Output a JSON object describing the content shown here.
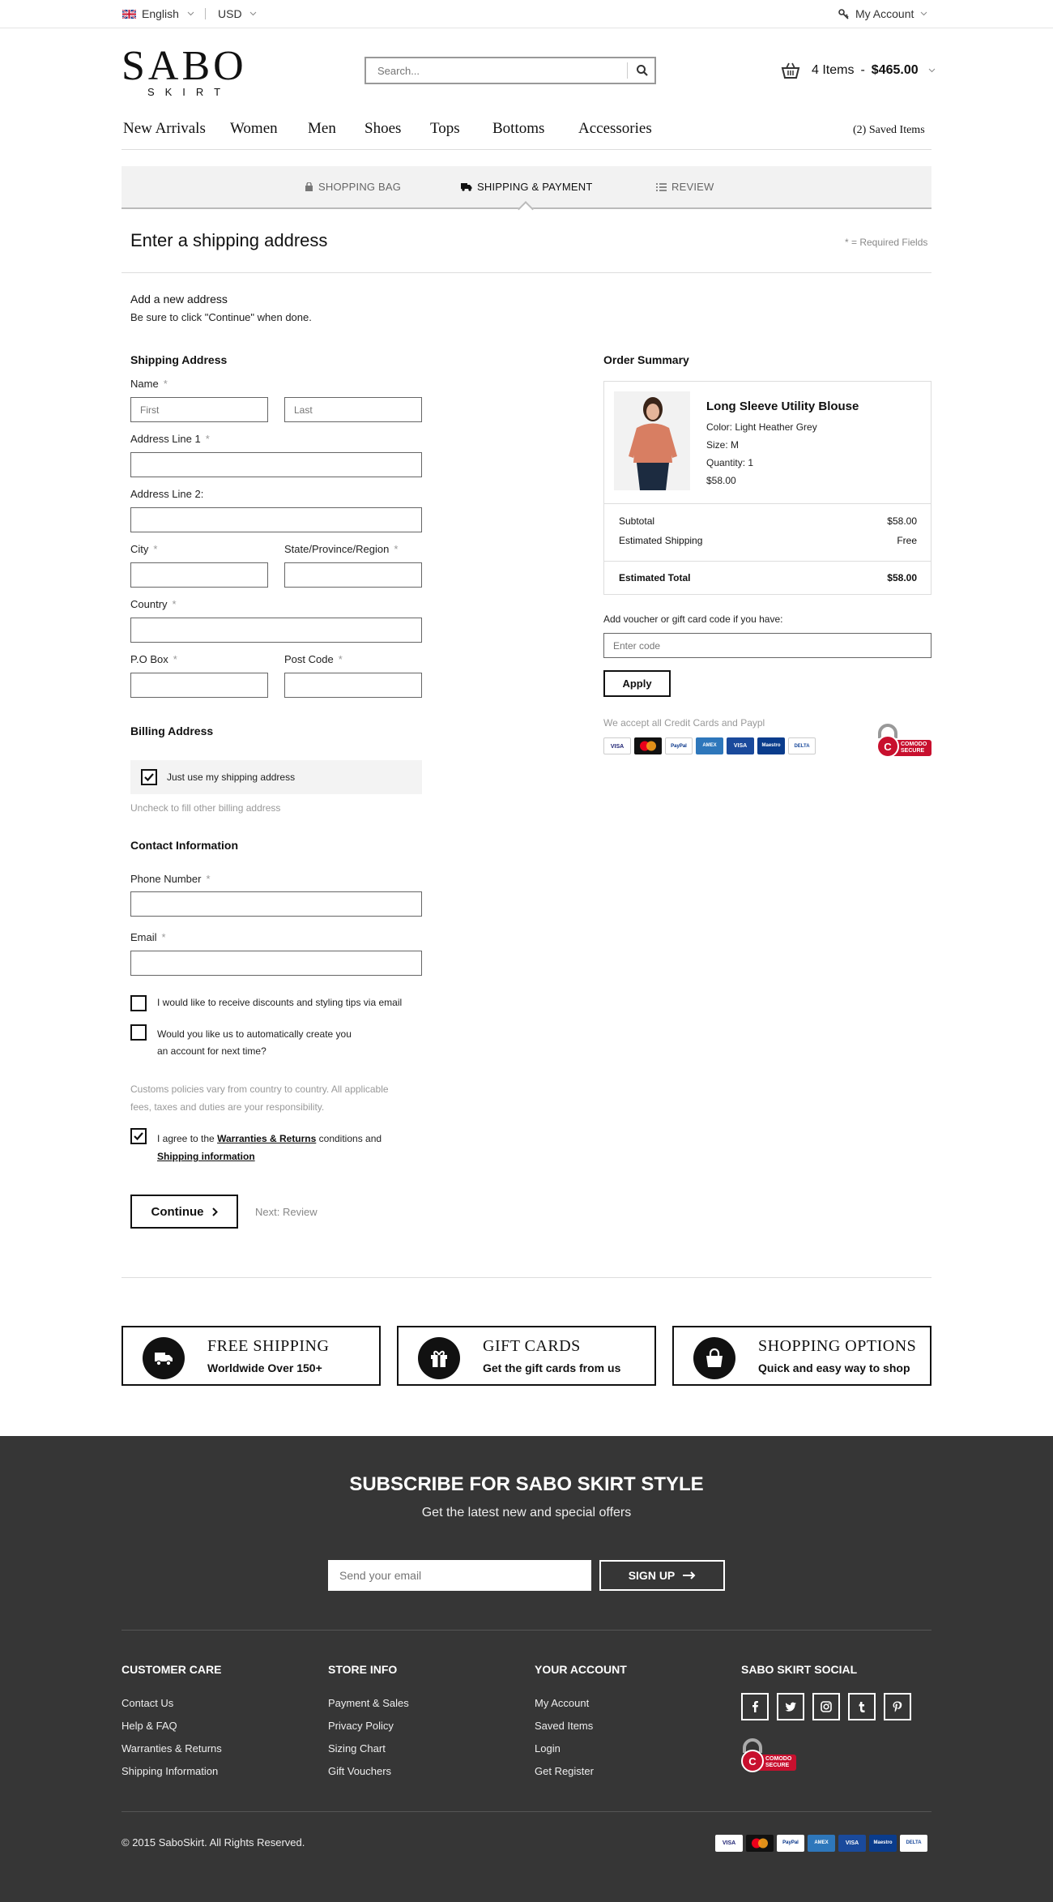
{
  "topbar": {
    "language": "English",
    "currency": "USD",
    "account": "My Account"
  },
  "header": {
    "logo_main": "SABO",
    "logo_sub": "SKIRT",
    "search_placeholder": "Search...",
    "cart_items": "4 Items",
    "cart_separator": "-",
    "cart_total": "$465.00"
  },
  "nav": {
    "items": [
      "New Arrivals",
      "Women",
      "Men",
      "Shoes",
      "Tops",
      "Bottoms",
      "Accessories"
    ],
    "saved": "(2) Saved Items"
  },
  "steps": {
    "bag": "SHOPPING BAG",
    "shipping": "SHIPPING & PAYMENT",
    "review": "REVIEW",
    "active": "shipping"
  },
  "page": {
    "title": "Enter a shipping address",
    "required_note": "* = Required Fields",
    "add_title": "Add a new address",
    "add_hint": "Be sure to click \"Continue\" when done."
  },
  "shipping": {
    "heading": "Shipping Address",
    "name_label": "Name",
    "first_placeholder": "First",
    "last_placeholder": "Last",
    "address1_label": "Address Line 1",
    "address2_label": "Address Line 2:",
    "city_label": "City",
    "state_label": "State/Province/Region",
    "country_label": "Country",
    "pobox_label": "P.O Box",
    "postcode_label": "Post Code",
    "required_mark": "*"
  },
  "billing": {
    "heading": "Billing Address",
    "same_label": "Just use my shipping address",
    "same_checked": true,
    "hint": "Uncheck to fill other billing address"
  },
  "contact": {
    "heading": "Contact Information",
    "phone_label": "Phone Number",
    "email_label": "Email",
    "opt_discounts": "I would like to receive discounts and styling tips via email",
    "opt_account_1": "Would you like us to automatically create you",
    "opt_account_2": "an account for next time?",
    "customs_1": "Customs policies vary from country to country. All applicable",
    "customs_2": "fees, taxes and duties are your responsibility.",
    "agree_pre": "I agree to the",
    "agree_link1": "Warranties & Returns",
    "agree_mid": "conditions and",
    "agree_link2": "Shipping information",
    "agree_checked": true,
    "continue": "Continue",
    "next": "Next: Review"
  },
  "summary": {
    "heading": "Order Summary",
    "product_name": "Long Sleeve Utility Blouse",
    "color": "Color: Light Heather Grey",
    "size": "Size: M",
    "quantity": "Quantity: 1",
    "price": "$58.00",
    "subtotal_label": "Subtotal",
    "subtotal": "$58.00",
    "shipping_label": "Estimated Shipping",
    "shipping": "Free",
    "total_label": "Estimated Total",
    "total": "$58.00",
    "voucher_label": "Add voucher or gift card code if you have:",
    "voucher_placeholder": "Enter code",
    "apply": "Apply",
    "cards_note": "We accept all Credit Cards and Paypl",
    "secure_line1": "COMODO",
    "secure_line2": "SECURE"
  },
  "cards": [
    "VISA",
    "MC",
    "PayPal",
    "AMEX",
    "VISA",
    "Maestro",
    "DELTA"
  ],
  "promos": [
    {
      "title": "FREE SHIPPING",
      "subtitle": "Worldwide Over 150+",
      "icon": "truck-icon"
    },
    {
      "title": "GIFT CARDS",
      "subtitle": "Get the gift cards from us",
      "icon": "gift-icon"
    },
    {
      "title": "SHOPPING OPTIONS",
      "subtitle": "Quick and easy way to shop",
      "icon": "bag-icon"
    }
  ],
  "footer": {
    "subscribe_title": "SUBSCRIBE FOR SABO SKIRT STYLE",
    "subscribe_sub": "Get the latest new and special offers",
    "email_placeholder": "Send your email",
    "signup": "SIGN UP",
    "cols": [
      {
        "title": "CUSTOMER CARE",
        "links": [
          "Contact Us",
          "Help & FAQ",
          "Warranties & Returns",
          "Shipping Information"
        ]
      },
      {
        "title": "STORE INFO",
        "links": [
          "Payment & Sales",
          "Privacy Policy",
          "Sizing Chart",
          "Gift Vouchers"
        ]
      },
      {
        "title": "YOUR ACCOUNT",
        "links": [
          "My Account",
          "Saved Items",
          "Login",
          "Get Register"
        ]
      },
      {
        "title": "SABO SKIRT SOCIAL",
        "links": []
      }
    ],
    "copyright": "© 2015 SaboSkirt. All Rights Reserved."
  },
  "colors": {
    "footer_bg": "#363636",
    "step_bar_bg": "#f2f2f2",
    "secure_red": "#c8102e"
  }
}
